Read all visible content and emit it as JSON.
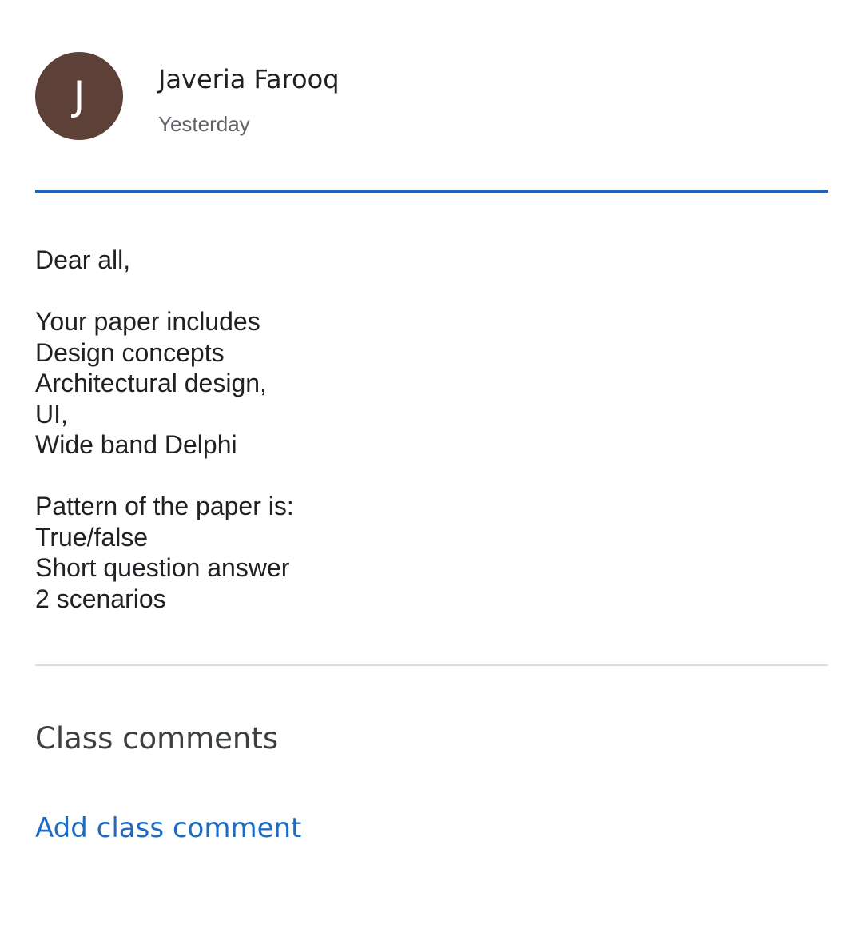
{
  "author": {
    "initial": "J",
    "name": "Javeria Farooq",
    "date": "Yesterday"
  },
  "post": {
    "greeting": "Dear all,",
    "paragraph1": [
      "Your paper includes",
      "Design concepts",
      "Architectural design,",
      "UI,",
      "Wide band Delphi"
    ],
    "paragraph2": [
      "Pattern of the paper is:",
      "True/false",
      "Short question answer",
      "2 scenarios"
    ]
  },
  "comments": {
    "heading": "Class comments",
    "add_label": "Add class comment"
  },
  "colors": {
    "avatar_bg": "#5d4037",
    "accent": "#1a67b8",
    "link": "#1f6bc0"
  }
}
